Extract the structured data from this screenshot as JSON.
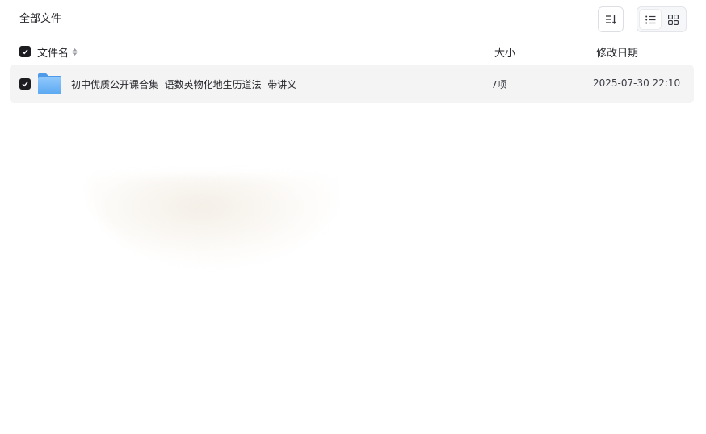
{
  "breadcrumb": {
    "current": "全部文件"
  },
  "toolbar": {
    "sort_icon": "sort-icon",
    "view_list_icon": "list-view-icon",
    "view_grid_icon": "grid-view-icon",
    "active_view": "list"
  },
  "table": {
    "columns": {
      "name": "文件名",
      "size": "大小",
      "modified": "修改日期"
    },
    "rows": [
      {
        "icon": "folder-icon",
        "name": "初中优质公开课合集  语数英物化地生历道法  带讲义",
        "size": "7项",
        "modified": "2025-07-30 22:10",
        "checked": true
      }
    ]
  },
  "colors": {
    "checkbox": "#1d1d21",
    "row_highlight": "#f4f4f5",
    "folder": "#6cb3f5"
  }
}
